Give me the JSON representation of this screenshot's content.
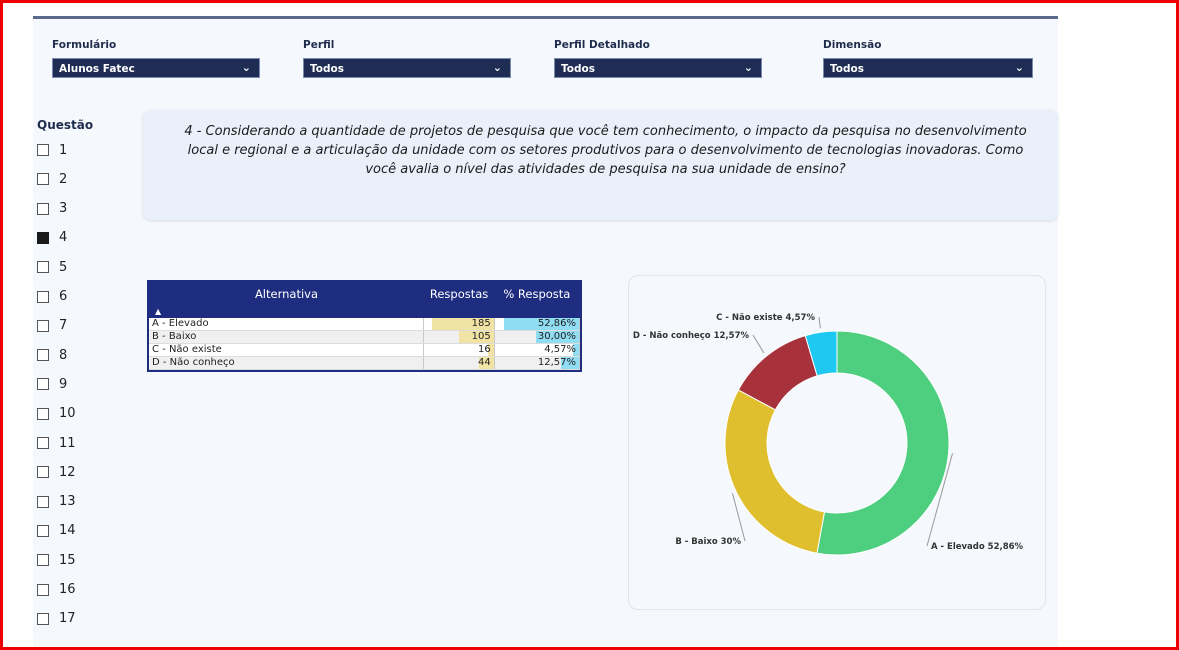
{
  "filters": [
    {
      "label": "Formulário",
      "value": "Alunos Fatec"
    },
    {
      "label": "Perfil",
      "value": "Todos"
    },
    {
      "label": "Perfil Detalhado",
      "value": "Todos"
    },
    {
      "label": "Dimensão",
      "value": "Todos"
    }
  ],
  "questions": {
    "title": "Questão",
    "items": [
      "1",
      "2",
      "3",
      "4",
      "5",
      "6",
      "7",
      "8",
      "9",
      "10",
      "11",
      "12",
      "13",
      "14",
      "15",
      "16",
      "17"
    ],
    "selected": "4"
  },
  "question_text": "4 - Considerando a quantidade de projetos de pesquisa que você tem conhecimento, o impacto da pesquisa no desenvolvimento local e regional e a articulação da unidade com os setores produtivos para o desenvolvimento de tecnologias inovadoras. Como você avalia o nível das atividades de pesquisa na sua unidade de ensino?",
  "table": {
    "headers": [
      "Alternativa",
      "Respostas",
      "% Resposta"
    ],
    "rows": [
      {
        "alternativa": "A - Elevado",
        "respostas": "185",
        "pct": "52,86%",
        "frac": 0.5286
      },
      {
        "alternativa": "B - Baixo",
        "respostas": "105",
        "pct": "30,00%",
        "frac": 0.3
      },
      {
        "alternativa": "C - Não existe",
        "respostas": "16",
        "pct": "4,57%",
        "frac": 0.0457
      },
      {
        "alternativa": "D - Não conheço",
        "respostas": "44",
        "pct": "12,57%",
        "frac": 0.1257
      }
    ]
  },
  "chart_data": {
    "type": "pie",
    "donut": true,
    "categories": [
      "A - Elevado",
      "B - Baixo",
      "D - Não conheço",
      "C - Não existe"
    ],
    "values": [
      52.86,
      30.0,
      12.57,
      4.57
    ],
    "colors": [
      "#4ecf80",
      "#e0bf2e",
      "#a8323c",
      "#1ec8f0"
    ],
    "labels": [
      "A - Elevado 52,86%",
      "B - Baixo 30%",
      "D - Não conheço 12,57%",
      "C - Não existe 4,57%"
    ]
  }
}
